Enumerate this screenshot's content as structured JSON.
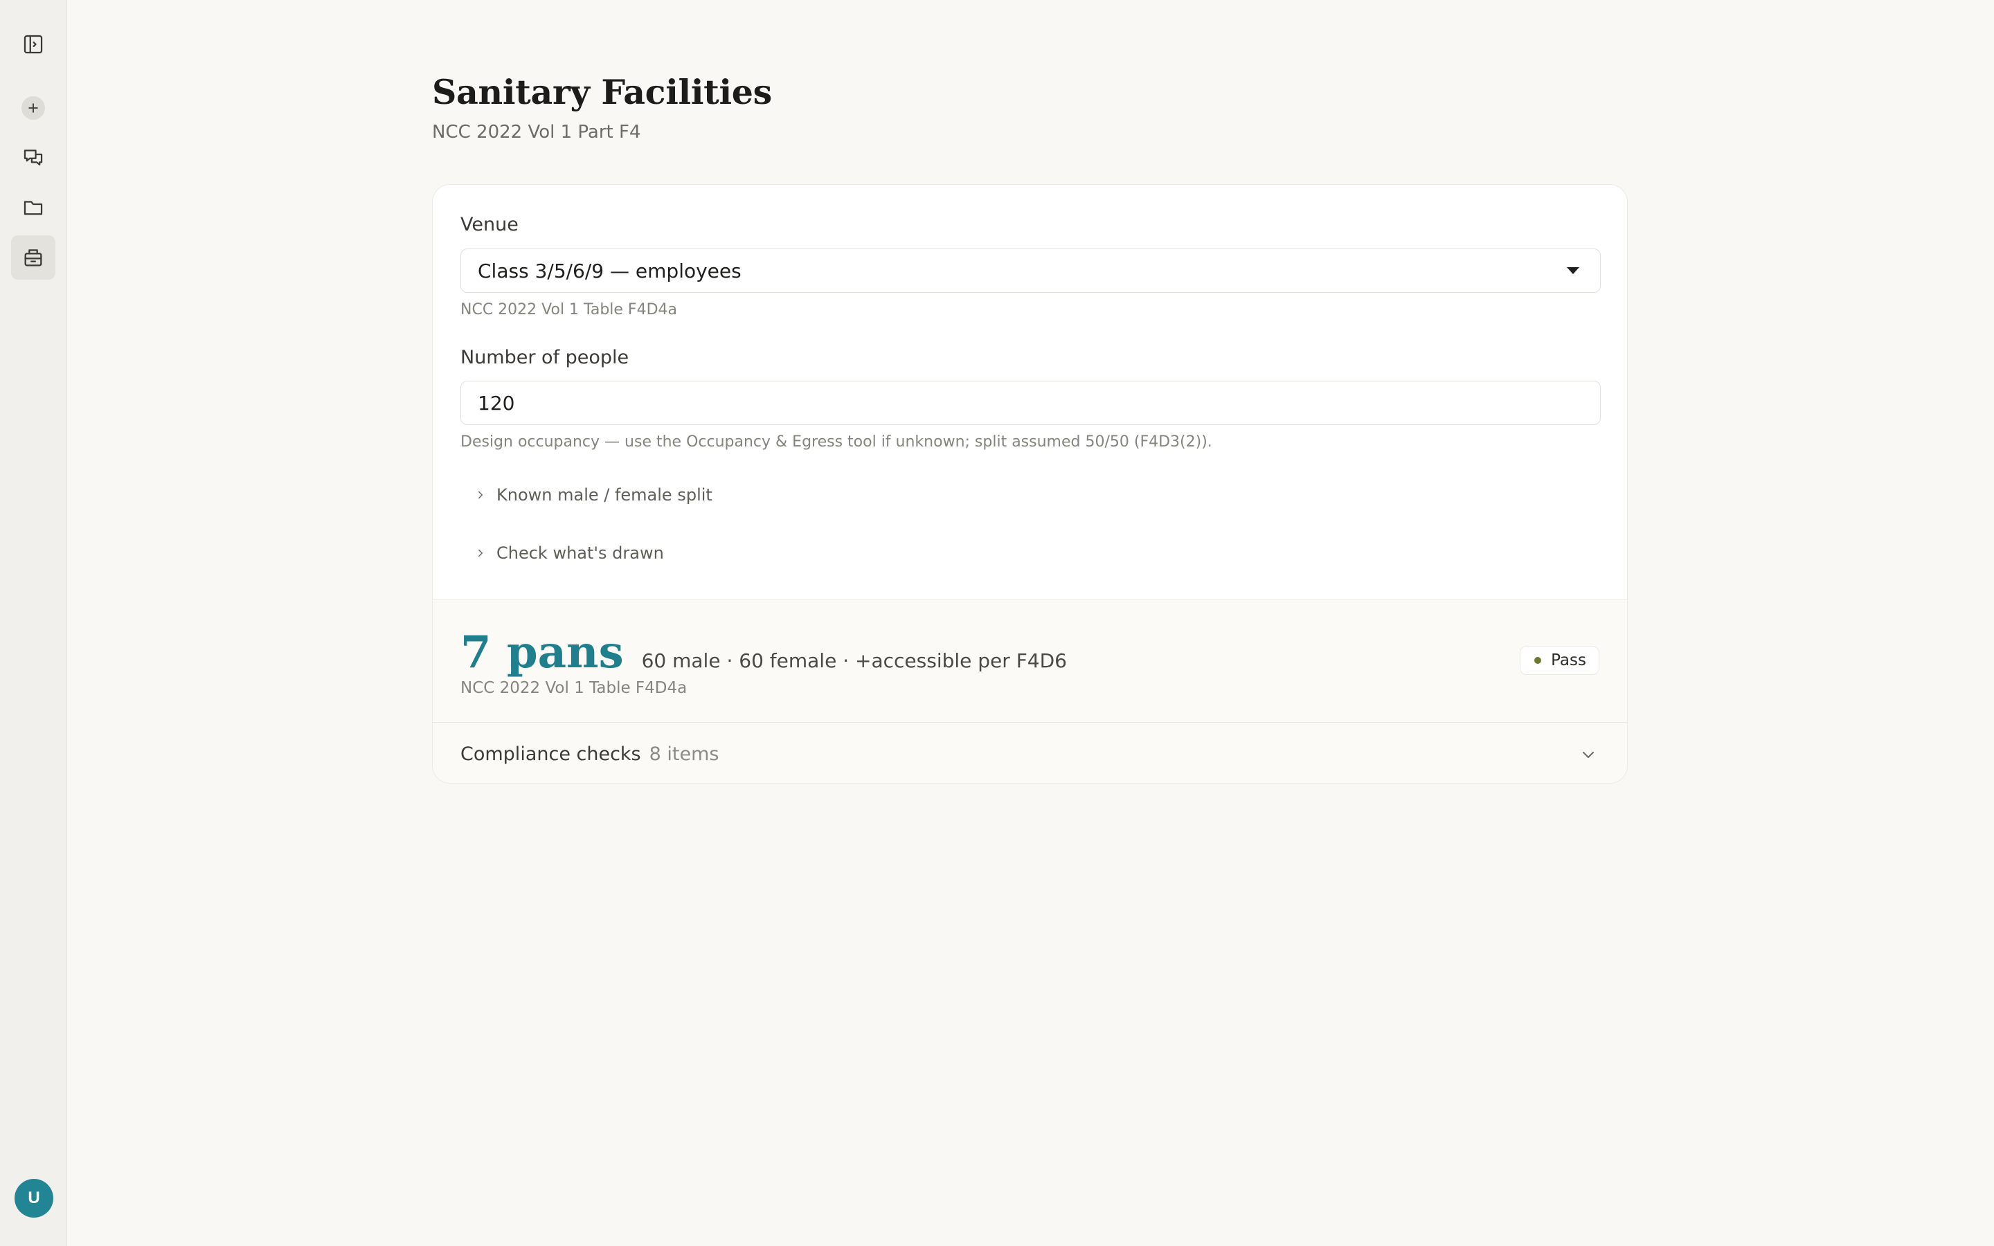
{
  "sidebar": {
    "items": [
      {
        "name": "toggle-sidebar",
        "icon": "sidebar-toggle-icon"
      },
      {
        "name": "new",
        "icon": "plus-icon"
      },
      {
        "name": "chats",
        "icon": "chat-bubbles-icon"
      },
      {
        "name": "projects",
        "icon": "folder-icon"
      },
      {
        "name": "tools",
        "icon": "toolbox-icon",
        "active": true
      }
    ],
    "avatar_initial": "U"
  },
  "header": {
    "title": "Sanitary Facilities",
    "subtitle": "NCC 2022 Vol 1 Part F4"
  },
  "form": {
    "venue": {
      "label": "Venue",
      "value": "Class 3/5/6/9 — employees",
      "help": "NCC 2022 Vol 1 Table F4D4a"
    },
    "people": {
      "label": "Number of people",
      "value": "120",
      "help": "Design occupancy — use the Occupancy & Egress tool if unknown; split assumed 50/50 (F4D3(2))."
    },
    "expanders": [
      {
        "label": "Known male / female split"
      },
      {
        "label": "Check what's drawn"
      }
    ]
  },
  "result": {
    "value": "7 pans",
    "detail": "60 male · 60 female · +accessible per F4D6",
    "reference": "NCC 2022 Vol 1 Table F4D4a",
    "status": "Pass",
    "status_color": "#6e7a32"
  },
  "checks": {
    "label": "Compliance checks",
    "count": "8 items"
  },
  "colors": {
    "accent": "#1f7f8d",
    "avatar": "#228594"
  }
}
